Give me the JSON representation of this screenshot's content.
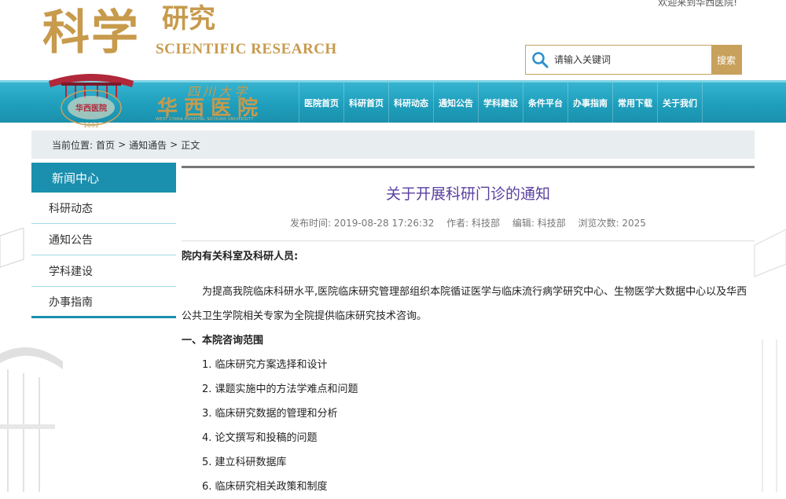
{
  "header": {
    "welcome": "欢迎来到华西医院!",
    "title_big": "科学",
    "title_small": "研究",
    "title_en": "SCIENTIFIC RESEARCH",
    "search_placeholder": "请输入关键词",
    "search_button": "搜索"
  },
  "logo": {
    "script": "四川大学",
    "name": "华西医院",
    "en": "WEST CHINA HOSPITAL SICHUAN UNIVERSITY",
    "year": "1892"
  },
  "nav": {
    "items": [
      "医院首页",
      "科研首页",
      "科研动态",
      "通知公告",
      "学科建设",
      "条件平台",
      "办事指南",
      "常用下载",
      "关于我们"
    ]
  },
  "breadcrumb": {
    "label": "当前位置:",
    "home": "首页",
    "sep": ">",
    "section": "通知通告",
    "current": "正文"
  },
  "sidebar": {
    "title": "新闻中心",
    "items": [
      "科研动态",
      "通知公告",
      "学科建设",
      "办事指南"
    ]
  },
  "article": {
    "title": "关于开展科研门诊的通知",
    "meta": {
      "publish": "发布时间: 2019-08-28 17:26:32",
      "author": "作者: 科技部",
      "editor": "编辑: 科技部",
      "views": "浏览次数: 2025"
    },
    "greeting": "院内有关科室及科研人员:",
    "paragraph": "为提高我院临床科研水平,医院临床研究管理部组织本院循证医学与临床流行病学研究中心、生物医学大数据中心以及华西公共卫生学院相关专家为全院提供临床研究技术咨询。",
    "section1": "一、本院咨询范围",
    "list": [
      "1. 临床研究方案选择和设计",
      "2. 课题实施中的方法学难点和问题",
      "3. 临床研究数据的管理和分析",
      "4. 论文撰写和投稿的问题",
      "5. 建立科研数据库",
      "6. 临床研究相关政策和制度"
    ]
  },
  "colors": {
    "gold": "#c79a4c",
    "nav_blue": "#1f9fbd",
    "title_purple": "#5a3fa0"
  }
}
